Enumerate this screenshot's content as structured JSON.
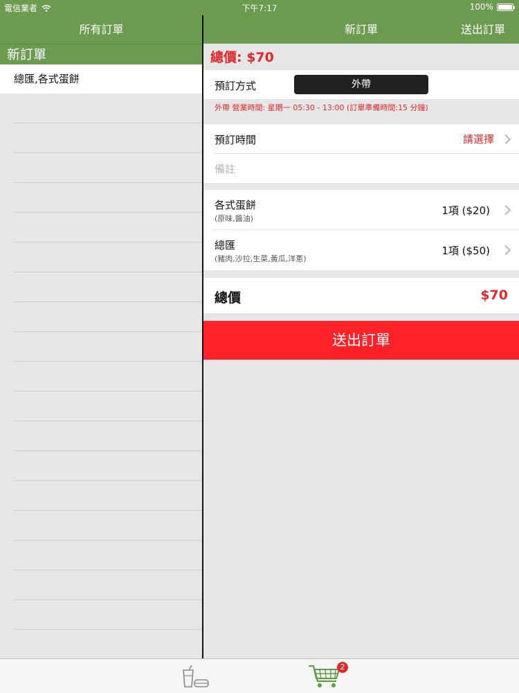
{
  "status_bar": {
    "carrier": "電信業者",
    "time": "下午7:17",
    "battery": "100%"
  },
  "left": {
    "nav_title": "所有訂單",
    "section_header": "新訂單",
    "orders": [
      "總匯,各式蛋餅"
    ]
  },
  "right": {
    "nav_title": "新訂單",
    "send_top_label": "送出訂單",
    "total_top": "總價: $70",
    "order_method": {
      "label": "預訂方式",
      "value": "外帶"
    },
    "hours_note": "外帶 營業時間: 星期一 05:30 - 13:00 (訂單準備時間:15 分鐘)",
    "order_time": {
      "label": "預訂時間",
      "value": "請選擇"
    },
    "notes_placeholder": "備註",
    "items": [
      {
        "name": "各式蛋餅",
        "sub": "(原味,醬油)",
        "qty": "1項 ($20)"
      },
      {
        "name": "總匯",
        "sub": "(豬肉,沙拉,生菜,黃瓜,洋蔥)",
        "qty": "1項 ($50)"
      }
    ],
    "total_label": "總價",
    "total_value": "$70",
    "submit_label": "送出訂單"
  },
  "tab_bar": {
    "tabs": [
      {
        "icon": "drink-food-icon"
      },
      {
        "icon": "cart-icon",
        "badge": "2"
      }
    ]
  },
  "colors": {
    "nav_green": "#6a9b4f",
    "accent_red": "#e3282c",
    "submit_red": "#fe2228"
  }
}
